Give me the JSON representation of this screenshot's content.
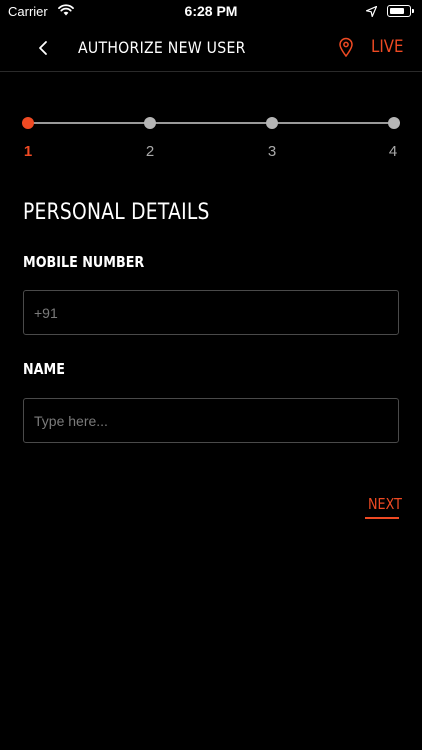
{
  "status_bar": {
    "carrier": "Carrier",
    "time": "6:28 PM",
    "battery_level": 0.8,
    "icons": [
      "wifi-icon",
      "location-arrow-icon",
      "battery-icon"
    ]
  },
  "header": {
    "title": "AUTHORIZE NEW USER",
    "live_label": "LIVE",
    "icons": [
      "chevron-left-icon",
      "map-pin-icon"
    ]
  },
  "stepper": {
    "current_step": 1,
    "steps": [
      {
        "label": "1"
      },
      {
        "label": "2"
      },
      {
        "label": "3"
      },
      {
        "label": "4"
      }
    ]
  },
  "form": {
    "section_title": "PERSONAL DETAILS",
    "mobile": {
      "label": "MOBILE NUMBER",
      "placeholder": "+91",
      "value": ""
    },
    "name": {
      "label": "NAME",
      "placeholder": "Type here...",
      "value": ""
    }
  },
  "actions": {
    "next_label": "NEXT"
  },
  "colors": {
    "background": "#000000",
    "accent": "#ef4a23",
    "inactive_step": "#b5b5b5",
    "input_border": "#4a4a4a",
    "divider": "#2a2a2a"
  }
}
